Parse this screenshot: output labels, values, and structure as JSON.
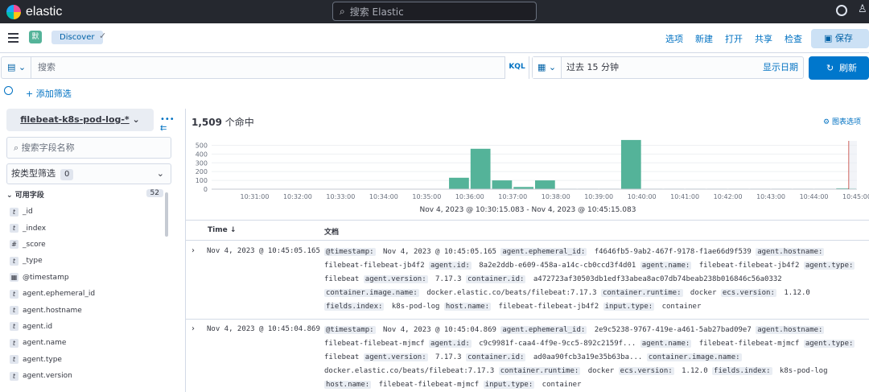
{
  "topbar": {
    "brand": "elastic",
    "search_placeholder": "搜索 Elastic"
  },
  "nav": {
    "avatar": "默",
    "breadcrumb": "Discover",
    "links": [
      "选项",
      "新建",
      "打开",
      "共享",
      "检查"
    ],
    "save": "保存"
  },
  "query": {
    "placeholder": "搜索",
    "language": "KQL",
    "time_range": "过去 15 分钟",
    "show_dates": "显示日期",
    "refresh": "刷新",
    "add_filter": "+ 添加筛选"
  },
  "sidebar": {
    "index_pattern": "filebeat-k8s-pod-log-*",
    "field_search_placeholder": "搜索字段名称",
    "filter_by_type": "按类型筛选",
    "filter_count": "0",
    "available_label": "可用字段",
    "available_count": "52",
    "fields": [
      {
        "type": "t",
        "name": "_id"
      },
      {
        "type": "t",
        "name": "_index"
      },
      {
        "type": "#",
        "name": "_score"
      },
      {
        "type": "t",
        "name": "_type"
      },
      {
        "type": "cal",
        "name": "@timestamp"
      },
      {
        "type": "t",
        "name": "agent.ephemeral_id"
      },
      {
        "type": "t",
        "name": "agent.hostname"
      },
      {
        "type": "t",
        "name": "agent.id"
      },
      {
        "type": "t",
        "name": "agent.name"
      },
      {
        "type": "t",
        "name": "agent.type"
      },
      {
        "type": "t",
        "name": "agent.version"
      }
    ]
  },
  "main": {
    "hit_count": "1,509",
    "hit_suffix": "个命中",
    "chart_options": "图表选项",
    "date_range": "Nov 4, 2023 @ 10:30:15.083 - Nov 4, 2023 @ 10:45:15.083",
    "col_time": "Time",
    "col_doc": "文档",
    "rows": [
      {
        "time": "Nov 4, 2023 @ 10:45:05.165",
        "doc": "@timestamp: Nov 4, 2023 @ 10:45:05.165 agent.ephemeral_id: f4646fb5-9ab2-467f-9178-f1ae66d9f539 agent.hostname: filebeat-filebeat-jb4f2 agent.id: 8a2e2ddb-e609-458a-a14c-cb0ccd3f4d01 agent.name: filebeat-filebeat-jb4f2 agent.type: filebeat agent.version: 7.17.3 container.id: a472723af30503db1edf33abea8ac07db74beab238b016846c56a0332 container.image.name: docker.elastic.co/beats/filebeat:7.17.3 container.runtime: docker ecs.version: 1.12.0 fields.index: k8s-pod-log host.name: filebeat-filebeat-jb4f2 input.type: container"
      },
      {
        "time": "Nov 4, 2023 @ 10:45:04.869",
        "doc": "@timestamp: Nov 4, 2023 @ 10:45:04.869 agent.ephemeral_id: 2e9c5238-9767-419e-a461-5ab27bad09e7 agent.hostname: filebeat-filebeat-mjmcf agent.id: c9c9981f-caa4-4f9e-9cc5-892c2159f... agent.name: filebeat-filebeat-mjmcf agent.type: filebeat agent.version: 7.17.3 container.id: ad0aa90fcb3a19e35b63ba... container.image.name: docker.elastic.co/beats/filebeat:7.17.3 container.runtime: docker ecs.version: 1.12.0 fields.index: k8s-pod-log host.name: filebeat-filebeat-mjmcf input.type: container"
      }
    ]
  },
  "chart_data": {
    "type": "bar",
    "title": "",
    "xlabel": "",
    "ylabel": "",
    "ylim": [
      0,
      550
    ],
    "yticks": [
      0,
      100,
      200,
      300,
      400,
      500
    ],
    "xticks": [
      "10:31:00",
      "10:32:00",
      "10:33:00",
      "10:34:00",
      "10:35:00",
      "10:36:00",
      "10:37:00",
      "10:38:00",
      "10:39:00",
      "10:40:00",
      "10:41:00",
      "10:42:00",
      "10:43:00",
      "10:44:00",
      "10:45:00"
    ],
    "categories": [
      "10:30:30",
      "10:31:00",
      "10:31:30",
      "10:32:00",
      "10:32:30",
      "10:33:00",
      "10:33:30",
      "10:34:00",
      "10:34:30",
      "10:35:00",
      "10:35:30",
      "10:36:00",
      "10:36:30",
      "10:37:00",
      "10:37:30",
      "10:38:00",
      "10:38:30",
      "10:39:00",
      "10:39:30",
      "10:40:00",
      "10:40:30",
      "10:41:00",
      "10:41:30",
      "10:42:00",
      "10:42:30",
      "10:43:00",
      "10:43:30",
      "10:44:00",
      "10:44:30",
      "10:45:00"
    ],
    "values": [
      0,
      0,
      0,
      0,
      0,
      0,
      0,
      0,
      0,
      0,
      0,
      130,
      460,
      100,
      25,
      100,
      5,
      5,
      5,
      560,
      5,
      5,
      5,
      5,
      5,
      5,
      5,
      5,
      5,
      10
    ],
    "color": "#54b399"
  }
}
